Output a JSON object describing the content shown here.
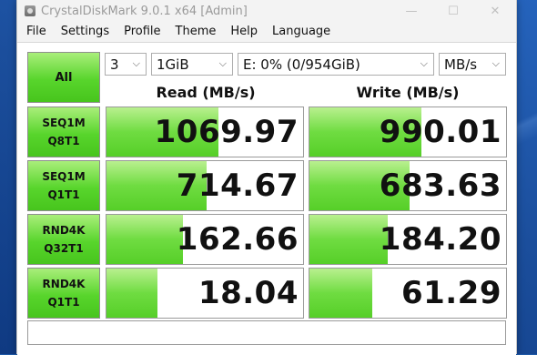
{
  "window": {
    "title": "CrystalDiskMark 9.0.1 x64 [Admin]",
    "controls": {
      "minimize": "—",
      "maximize": "☐",
      "close": "✕"
    }
  },
  "menu": [
    "File",
    "Settings",
    "Profile",
    "Theme",
    "Help",
    "Language"
  ],
  "toolbar": {
    "all_label": "All",
    "count": "3",
    "size": "1GiB",
    "drive": "E: 0% (0/954GiB)",
    "unit": "MB/s"
  },
  "headers": {
    "read": "Read (MB/s)",
    "write": "Write (MB/s)"
  },
  "tests": [
    {
      "line1": "SEQ1M",
      "line2": "Q8T1",
      "read": "1069.97",
      "write": "990.01",
      "read_fill": 0.57,
      "write_fill": 0.57
    },
    {
      "line1": "SEQ1M",
      "line2": "Q1T1",
      "read": "714.67",
      "write": "683.63",
      "read_fill": 0.51,
      "write_fill": 0.51
    },
    {
      "line1": "RND4K",
      "line2": "Q32T1",
      "read": "162.66",
      "write": "184.20",
      "read_fill": 0.39,
      "write_fill": 0.4
    },
    {
      "line1": "RND4K",
      "line2": "Q1T1",
      "read": "18.04",
      "write": "61.29",
      "read_fill": 0.26,
      "write_fill": 0.32
    }
  ],
  "comment": ""
}
